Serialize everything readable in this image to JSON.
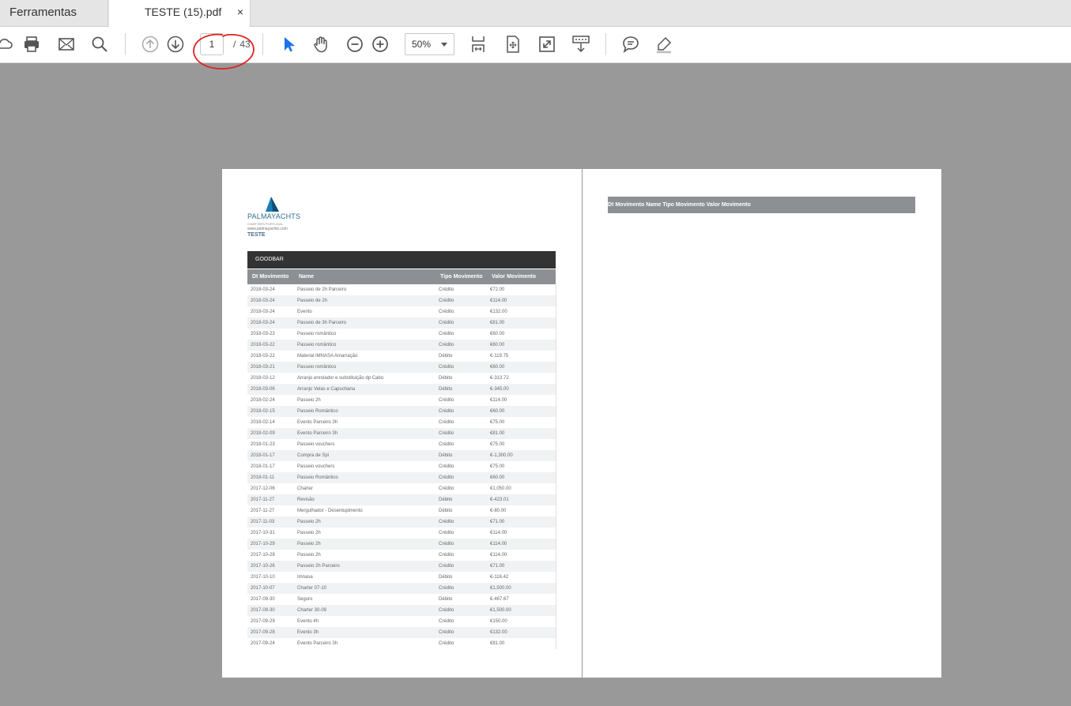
{
  "tabs": {
    "tools": "Ferramentas",
    "document": "TESTE (15).pdf",
    "close": "×"
  },
  "toolbar": {
    "icons": [
      "cloud-icon",
      "print-icon",
      "mail-icon",
      "search-icon",
      "page-up-icon",
      "page-down-icon",
      "select-arrow-icon",
      "hand-icon",
      "zoom-out-icon",
      "zoom-in-icon",
      "fit-width-icon",
      "fit-page-icon",
      "fullscreen-icon",
      "scroll-mode-icon",
      "comment-icon",
      "highlight-pen-icon"
    ],
    "page_current": "1",
    "page_sep": "/",
    "page_total": "43",
    "zoom": "50%"
  },
  "colors": {
    "accent": "#1a73e8",
    "annotation": "#e02020",
    "header_dark": "#333333",
    "header_grey": "#8c9094"
  },
  "pdf": {
    "logo_brand": "PALMAYACHTS",
    "logo_tagline": "CHARTERS PORTUGAL",
    "logo_url": "www.palmayachts.com",
    "client": "TESTE",
    "section": "GOODBAR",
    "columns": [
      "Dt Movimento",
      "Name",
      "Tipo Movimento",
      "Valor Movimento"
    ],
    "rows": [
      [
        "2018-03-24",
        "Passeio de 2h Parceiro",
        "Crédito",
        "€72.00"
      ],
      [
        "2018-03-24",
        "Passeio de 2h",
        "Crédito",
        "€114.00"
      ],
      [
        "2018-03-24",
        "Evento",
        "Crédito",
        "€132.00"
      ],
      [
        "2018-03-24",
        "Passeio de 3h Parceiro",
        "Crédito",
        "€81.00"
      ],
      [
        "2018-03-23",
        "Passeio romântico",
        "Crédito",
        "€60.00"
      ],
      [
        "2018-03-22",
        "Passeio romântico",
        "Crédito",
        "€60.00"
      ],
      [
        "2018-03-22",
        "Material IMNASA Amarração",
        "Débito",
        "€-119.75"
      ],
      [
        "2018-03-21",
        "Passeio romântico",
        "Crédito",
        "€60.00"
      ],
      [
        "2018-03-12",
        "Arranjo enrolador e substituição dp Cabo",
        "Débito",
        "€-313.72"
      ],
      [
        "2018-03-06",
        "Arranjo Velas e Capuchana",
        "Débito",
        "€-345.00"
      ],
      [
        "2018-02-24",
        "Passeio 2h",
        "Crédito",
        "€114.00"
      ],
      [
        "2018-02-15",
        "Passeio Romântico",
        "Crédito",
        "€60.00"
      ],
      [
        "2018-02-14",
        "Evento Parceiro 3h",
        "Crédito",
        "€75.00"
      ],
      [
        "2018-02-09",
        "Evento Parceiro 3h",
        "Crédito",
        "€81.00"
      ],
      [
        "2018-01-23",
        "Passeio vouchers",
        "Crédito",
        "€75.00"
      ],
      [
        "2018-01-17",
        "Compra de Spi",
        "Débito",
        "€-1,300.00"
      ],
      [
        "2018-01-17",
        "Passeio vouchers",
        "Crédito",
        "€75.00"
      ],
      [
        "2018-01-11",
        "Passeio Romântico",
        "Crédito",
        "€60.00"
      ],
      [
        "2017-12-06",
        "Charter",
        "Crédito",
        "€1,050.00"
      ],
      [
        "2017-11-27",
        "Revisão",
        "Débito",
        "€-423.01"
      ],
      [
        "2017-11-27",
        "Mergulhador - Desentupimento",
        "Débito",
        "€-80.00"
      ],
      [
        "2017-11-03",
        "Passeio 2h",
        "Crédito",
        "€71.00"
      ],
      [
        "2017-10-31",
        "Passeio 2h",
        "Crédito",
        "€114.00"
      ],
      [
        "2017-10-29",
        "Passeio 2h",
        "Crédito",
        "€114.00"
      ],
      [
        "2017-10-28",
        "Passeio 2h",
        "Crédito",
        "€114.00"
      ],
      [
        "2017-10-26",
        "Passeio 2h Parceiro",
        "Crédito",
        "€71.00"
      ],
      [
        "2017-10-10",
        "Imnasa",
        "Débito",
        "€-116.42"
      ],
      [
        "2017-10-07",
        "Charter 07-10",
        "Crédito",
        "€1,500.00"
      ],
      [
        "2017-09-30",
        "Seguro",
        "Débito",
        "€-467.67"
      ],
      [
        "2017-09-30",
        "Charter 30-09",
        "Crédito",
        "€1,500.00"
      ],
      [
        "2017-09-29",
        "Evento 4h",
        "Crédito",
        "€150.00"
      ],
      [
        "2017-09-28",
        "Evento 3h",
        "Crédito",
        "€132.00"
      ],
      [
        "2017-09-24",
        "Evento Parceiro 3h",
        "Crédito",
        "€81.00"
      ]
    ]
  }
}
